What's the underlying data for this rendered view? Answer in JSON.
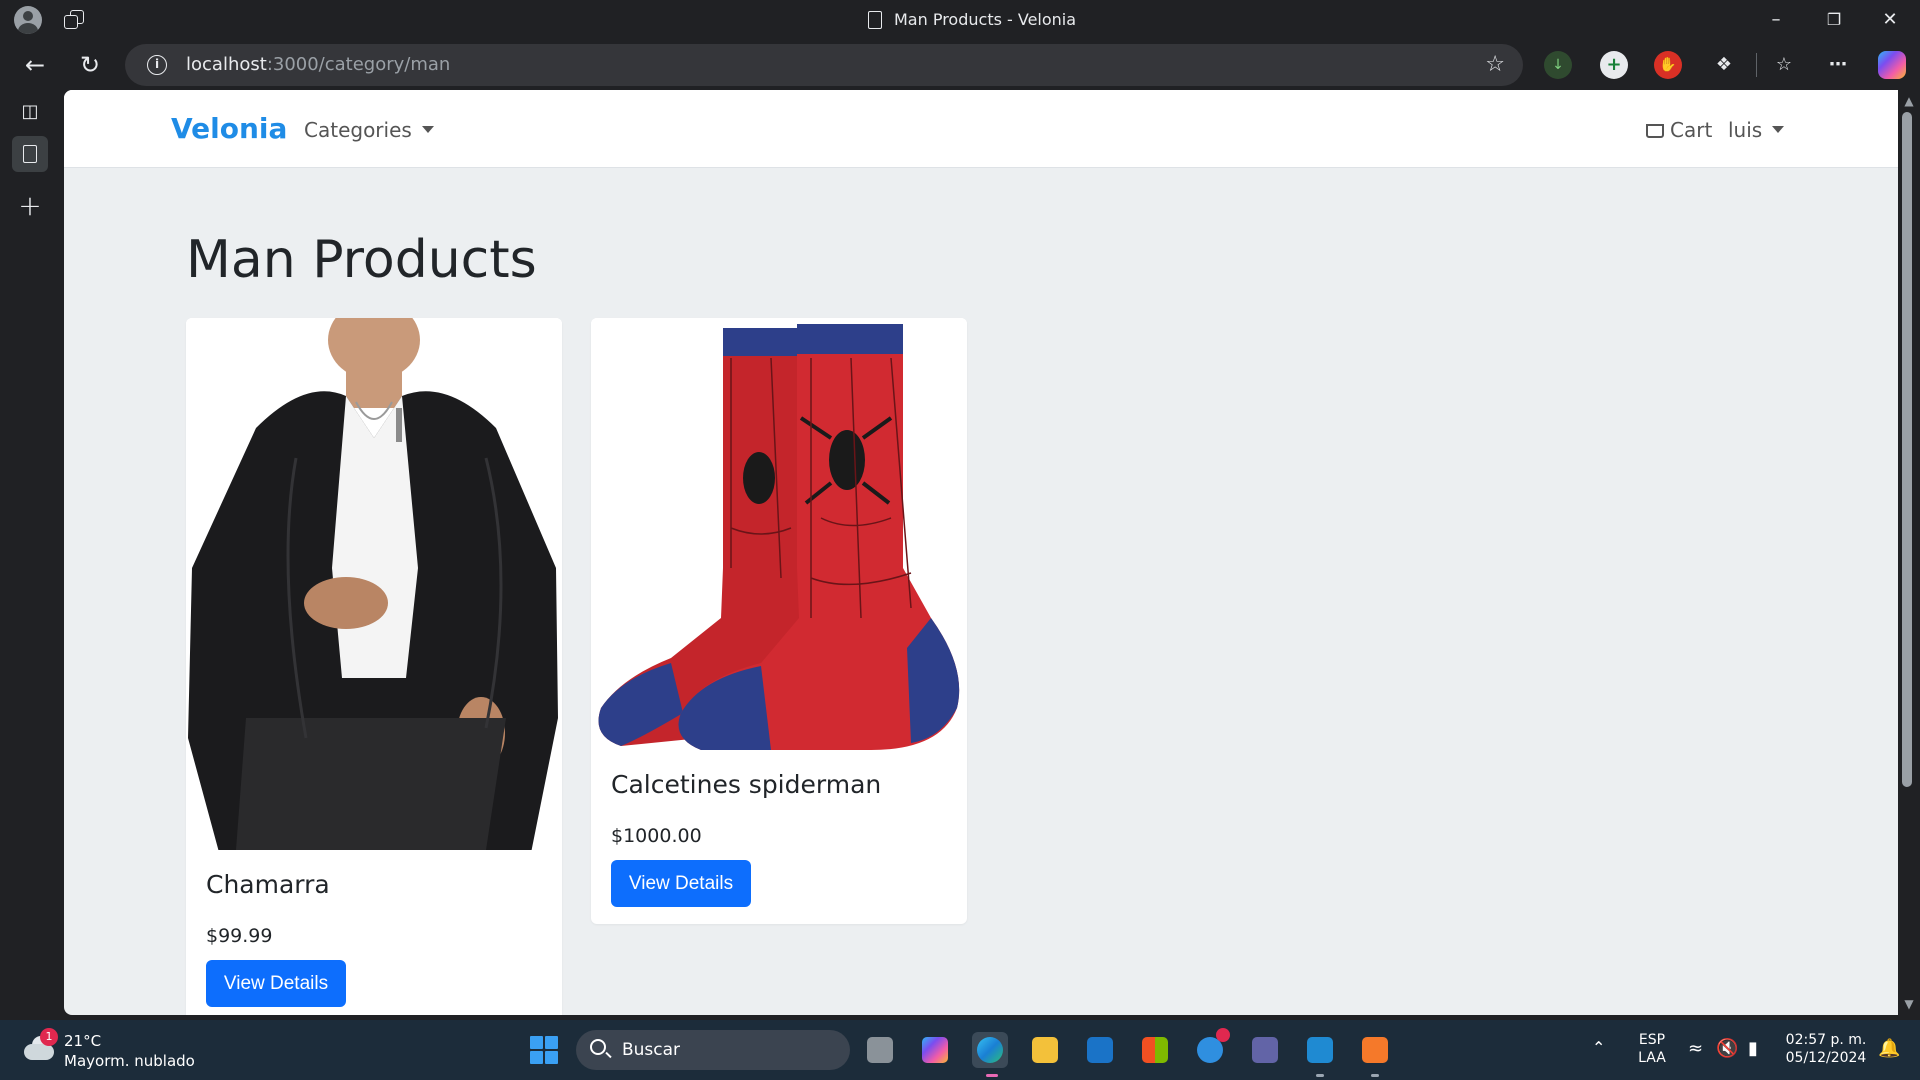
{
  "browser": {
    "window_title": "Man Products - Velonia",
    "url_host": "localhost",
    "url_rest": ":3000/category/man"
  },
  "site": {
    "brand": "Velonia",
    "categories_label": "Categories",
    "cart_label": "Cart",
    "user_label": "luis"
  },
  "page": {
    "title": "Man Products",
    "products": [
      {
        "name": "Chamarra",
        "price": "$99.99",
        "button": "View Details"
      },
      {
        "name": "Calcetines spiderman",
        "price": "$1000.00",
        "button": "View Details"
      }
    ]
  },
  "taskbar": {
    "weather_badge": "1",
    "weather_temp": "21°C",
    "weather_desc": "Mayorm. nublado",
    "search_placeholder": "Buscar",
    "lang_line1": "ESP",
    "lang_line2": "LAA",
    "time": "02:57 p. m.",
    "date": "05/12/2024"
  },
  "colors": {
    "brand": "#1f8ce6",
    "button": "#0d6efd",
    "page_bg": "#eceff1",
    "chrome_bg": "#202124",
    "taskbar_bg": "#1c2c3a"
  }
}
